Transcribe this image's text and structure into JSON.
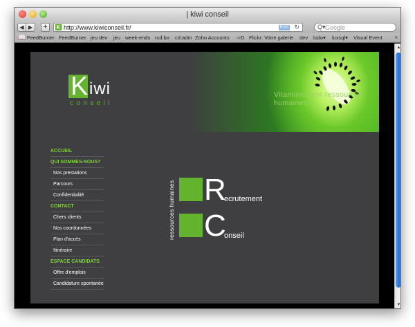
{
  "window": {
    "title": "| kiwi conseil"
  },
  "toolbar": {
    "back_glyph": "◀",
    "forward_glyph": "▶",
    "add_glyph": "+",
    "url": "http://www.kiwiconseil.fr/",
    "favicon_letter": "K",
    "rss_label": "RSS",
    "reload_glyph": "↻",
    "search_placeholder": "Google",
    "search_glyph": "Q▾"
  },
  "bookmarks": {
    "book_glyph": "📖",
    "items": [
      "FeedBurner",
      "FeedBurner",
      "jeu dev",
      "jeu",
      "week-ends",
      "rcd:bo",
      "cd:adm",
      "Zoho Accounts",
      "->D",
      "Flickr: Votre galerie",
      "dev",
      "ludo▾",
      "luxsql▾",
      "Visual Event"
    ],
    "more_glyph": "»"
  },
  "site": {
    "logo": {
      "k": "K",
      "iwi": "iwi",
      "conseil": "conseil"
    },
    "tagline": "Vitaminez vos ressources humaines",
    "nav": [
      {
        "label": "ACCUEIL",
        "kind": "section"
      },
      {
        "label": "QUI SOMMES-NOUS?",
        "kind": "section"
      },
      {
        "label": "Nos prestations",
        "kind": "sub"
      },
      {
        "label": "Parcours",
        "kind": "sub"
      },
      {
        "label": "Confidentialité",
        "kind": "sub"
      },
      {
        "label": "CONTACT",
        "kind": "section"
      },
      {
        "label": "Chers clients",
        "kind": "sub"
      },
      {
        "label": "Nos coordonnées",
        "kind": "sub"
      },
      {
        "label": "Plan d'accès",
        "kind": "sub"
      },
      {
        "label": "Itinéraire",
        "kind": "sub"
      },
      {
        "label": "ESPACE CANDIDATS",
        "kind": "section"
      },
      {
        "label": "Offre d'emplois",
        "kind": "sub"
      },
      {
        "label": "Candidature spontanée",
        "kind": "sub"
      }
    ],
    "services": {
      "vertical_label": "ressources humaines",
      "recruitment": {
        "letter": "R",
        "rest": "ecrutement"
      },
      "consulting": {
        "letter": "C",
        "rest": "onseil"
      }
    },
    "colors": {
      "accent_green": "#63b32e",
      "nav_section_green": "#7ed23b",
      "background": "#3f3f41"
    }
  },
  "scrollbar": {
    "up_glyph": "▲",
    "down_glyph": "▼",
    "position": 0.0
  }
}
